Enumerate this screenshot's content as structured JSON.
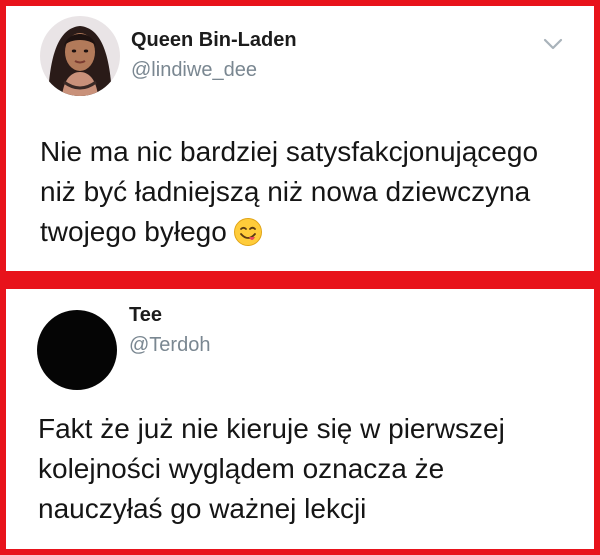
{
  "tweets": [
    {
      "display_name": "Queen Bin-Laden",
      "handle": "@lindiwe_dee",
      "text_lines": [
        "Nie ma nic bardziej satysfakcjonującego",
        "niż być ładniejszą niż nowa dziewczyna",
        "twojego byłego"
      ],
      "emoji": "face-savoring-food-icon"
    },
    {
      "display_name": "Tee",
      "handle": "@Terdoh",
      "text_lines": [
        "Fakt że już nie kieruje się w pierwszej",
        "kolejności wyglądem oznacza że",
        "nauczyłaś go ważnej lekcji"
      ]
    }
  ],
  "colors": {
    "frame_border": "#e8131b",
    "handle_text": "#7a8791",
    "body_text": "#151515"
  }
}
